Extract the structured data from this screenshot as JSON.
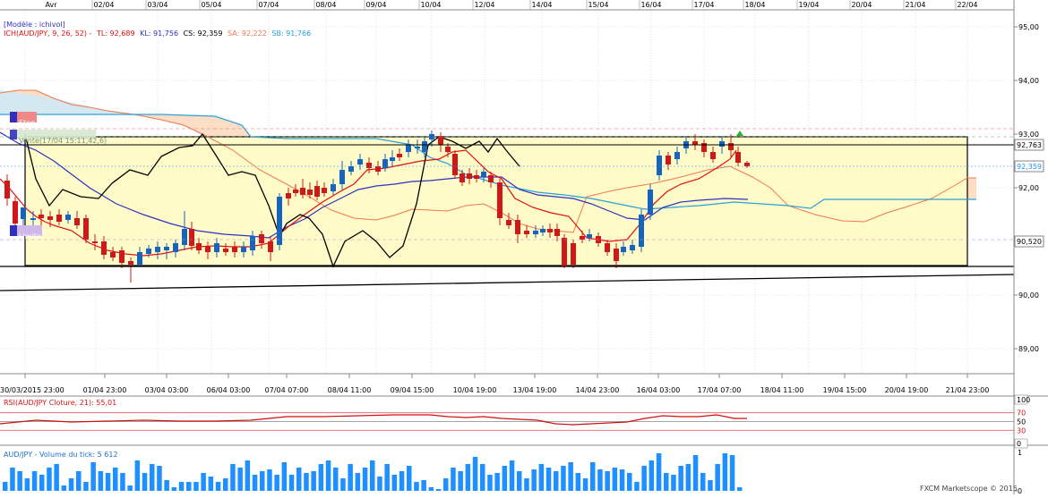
{
  "top_axis": {
    "month_label": "Avr",
    "dates": [
      "02/04",
      "03/04",
      "05/04",
      "07/04",
      "08/04",
      "09/04",
      "10/04",
      "12/04",
      "14/04",
      "15/04",
      "16/04",
      "17/04",
      "18/04",
      "19/04",
      "20/04",
      "21/04",
      "22/04"
    ]
  },
  "bottom_axis": {
    "labels": [
      "30/03/2015 23:00",
      "01/04 23:00",
      "03/04 03:00",
      "06/04 03:00",
      "07/04 07:00",
      "08/04 11:00",
      "09/04 15:00",
      "10/04 19:00",
      "13/04 19:00",
      "14/04 23:00",
      "16/04 03:00",
      "17/04 07:00",
      "18/04 11:00",
      "19/04 15:00",
      "20/04 19:00",
      "21/04 23:00"
    ]
  },
  "price_axis": {
    "ticks": [
      "95,00",
      "94,00",
      "93,00",
      "92,00",
      "91,00",
      "90,00",
      "89,00"
    ],
    "badges": [
      {
        "value": "92,763",
        "fill": "#ffffff",
        "text_color": "#000000"
      },
      {
        "value": "92,359",
        "fill": "#ffffff",
        "text_color": "#1e90ff"
      },
      {
        "value": "90,520",
        "fill": "#ffffff",
        "text_color": "#000000"
      }
    ]
  },
  "legend": {
    "model": "[Modèle : ichivol]",
    "ich_label": "ICH(AUD/JPY, 9, 26, 52) -",
    "tl": "TL: 92,689",
    "kl": "KL: 91,756",
    "cs": "CS: 92,359",
    "sa": "SA: 92,222",
    "sb": "SB: 91,766"
  },
  "orders": {
    "stop_label": "Stop",
    "vente_label": "Vente(17/04 15:11,42,6)",
    "limite_label": "Limite"
  },
  "rsi_panel": {
    "title": "RSI(AUD/JPY Cloture, 21): 55,01",
    "ticks": [
      "100",
      "70",
      "50",
      "30",
      "0"
    ]
  },
  "volume_panel": {
    "title": "AUD/JPY - Volume du tick: 5 612",
    "tick_top": "1",
    "tick_bottom": "0"
  },
  "copyright": "FXCM Marketscope © 2015",
  "colors": {
    "bull": "#1565c0",
    "bear": "#d01818",
    "tenkan": "#e01010",
    "kijun": "#3030c0",
    "chikou": "#000000",
    "senkou_a": "#f07850",
    "senkou_b": "#2aa0d8",
    "kumo_bear": "#fbd8bc",
    "kumo_bull": "#d6ecd0",
    "rect_fill": "#fffbc8",
    "volume": "#1e90ff"
  }
}
